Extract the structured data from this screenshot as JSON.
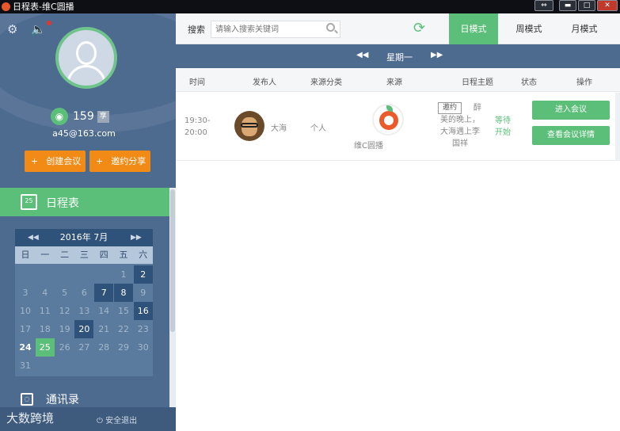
{
  "window": {
    "title": "日程表-维C圆播",
    "controls": [
      "⇔",
      "▬",
      "□",
      "✕"
    ]
  },
  "sidebar": {
    "settings_icon": "gear-icon",
    "sound_icon": "speaker-icon",
    "user": {
      "id": "159",
      "badge": "享",
      "email": "a45@163.com"
    },
    "buttons": {
      "create": "创建会议",
      "invite": "邀约分享",
      "plus": "+"
    },
    "schedule_label": "日程表",
    "schedule_icon_day": "25",
    "calendar": {
      "month_label": "2016年 7月",
      "weekdays": [
        "日",
        "一",
        "二",
        "三",
        "四",
        "五",
        "六"
      ],
      "days": [
        "",
        "",
        "",
        "",
        "",
        "1",
        "2",
        "3",
        "4",
        "5",
        "6",
        "7",
        "8",
        "9",
        "10",
        "11",
        "12",
        "13",
        "14",
        "15",
        "16",
        "17",
        "18",
        "19",
        "20",
        "21",
        "22",
        "23",
        "24",
        "25",
        "26",
        "27",
        "28",
        "29",
        "30",
        "31"
      ],
      "selected_day": "25"
    },
    "contacts_label": "通讯录",
    "footer": {
      "brand": "大数跨境",
      "logout": "安全退出"
    }
  },
  "main": {
    "search_label": "搜索",
    "search_placeholder": "请输入搜索关键词",
    "modes": [
      "日模式",
      "周模式",
      "月模式"
    ],
    "active_mode": "日模式",
    "day_label": "星期一",
    "columns": [
      "时间",
      "发布人",
      "来源分类",
      "来源",
      "日程主题",
      "状态",
      "操作"
    ],
    "rows": [
      {
        "time_start": "19:30-",
        "time_end": "20:00",
        "publisher": "大海",
        "category": "个人",
        "source": "维C圆播",
        "tag": "邀约",
        "theme_line1": "醉",
        "theme_line2": "美的晚上，",
        "theme_line3": "大海遇上李",
        "theme_line4": "国祥",
        "status_line1": "等待",
        "status_line2": "开始",
        "action_join": "进入会议",
        "action_detail": "查看会议详情"
      }
    ]
  },
  "colors": {
    "accent": "#5cbf79",
    "sidebar": "#4d6a8f",
    "orange": "#f28a16"
  }
}
